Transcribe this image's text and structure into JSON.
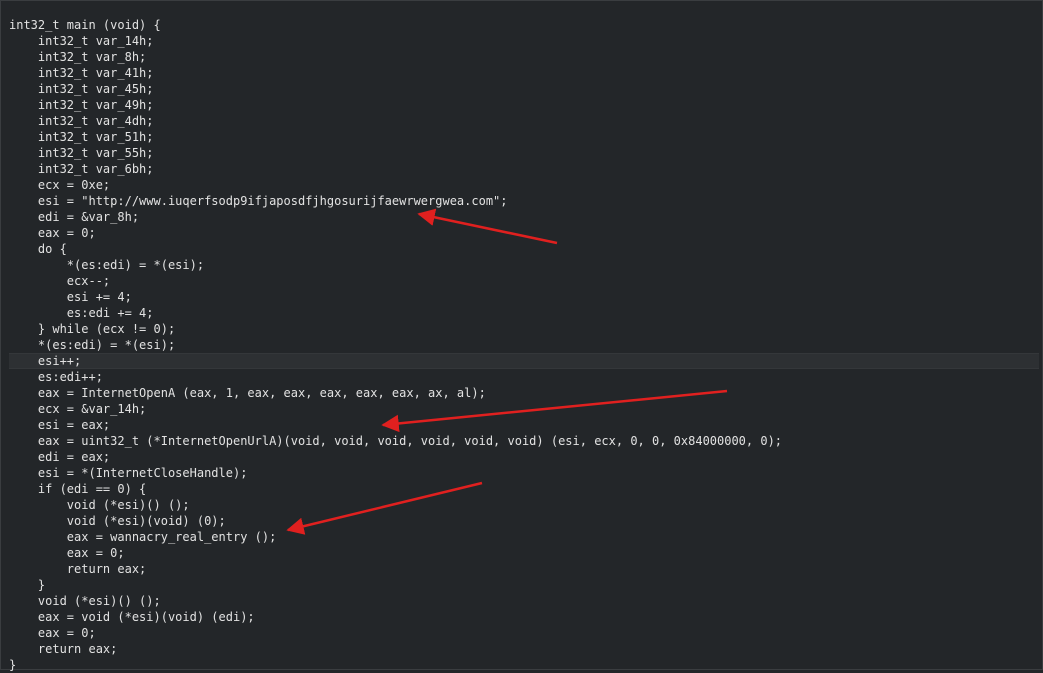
{
  "code_lines": [
    "int32_t main (void) {",
    "    int32_t var_14h;",
    "    int32_t var_8h;",
    "    int32_t var_41h;",
    "    int32_t var_45h;",
    "    int32_t var_49h;",
    "    int32_t var_4dh;",
    "    int32_t var_51h;",
    "    int32_t var_55h;",
    "    int32_t var_6bh;",
    "    ecx = 0xe;",
    "    esi = \"http://www.iuqerfsodp9ifjaposdfjhgosurijfaewrwergwea.com\";",
    "    edi = &var_8h;",
    "    eax = 0;",
    "    do {",
    "        *(es:edi) = *(esi);",
    "        ecx--;",
    "        esi += 4;",
    "        es:edi += 4;",
    "    } while (ecx != 0);",
    "    *(es:edi) = *(esi);",
    "    esi++;",
    "    es:edi++;",
    "    eax = InternetOpenA (eax, 1, eax, eax, eax, eax, eax, ax, al);",
    "    ecx = &var_14h;",
    "    esi = eax;",
    "    eax = uint32_t (*InternetOpenUrlA)(void, void, void, void, void, void) (esi, ecx, 0, 0, 0x84000000, 0);",
    "    edi = eax;",
    "    esi = *(InternetCloseHandle);",
    "    if (edi == 0) {",
    "        void (*esi)() ();",
    "        void (*esi)(void) (0);",
    "        eax = wannacry_real_entry ();",
    "        eax = 0;",
    "        return eax;",
    "    }",
    "    void (*esi)() ();",
    "    eax = void (*esi)(void) (edi);",
    "    eax = 0;",
    "    return eax;",
    "}"
  ],
  "current_line_index": 21,
  "colors": {
    "background": "#232629",
    "text": "#e2e2e2",
    "current_line": "#2d3033",
    "annotation_arrow": "#e0201f"
  },
  "annotations": [
    {
      "name": "arrow-to-url",
      "points_to": "http://www.iuqerfsodp9ifjaposdfjhgosurijfaewrwergwea.com"
    },
    {
      "name": "arrow-to-esi-eax",
      "points_to": "esi = eax;"
    },
    {
      "name": "arrow-to-wannacry-entry",
      "points_to": "eax = wannacry_real_entry ();"
    }
  ]
}
